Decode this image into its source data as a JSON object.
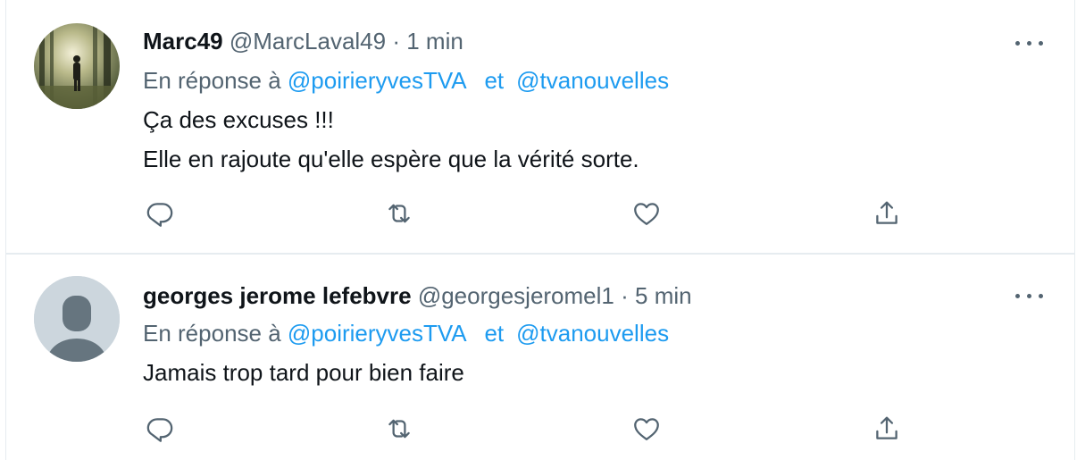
{
  "tweets": [
    {
      "name": "Marc49",
      "handle": "@MarcLaval49",
      "dot": "·",
      "time": "1 min",
      "reply_prefix": "En réponse à",
      "reply_to_1": "@poirieryvesTVA",
      "reply_and": "et",
      "reply_to_2": "@tvanouvelles",
      "text_line_1": "Ça des excuses !!!",
      "text_line_2": "Elle en rajoute qu'elle espère que la vérité sorte."
    },
    {
      "name": "georges jerome lefebvre",
      "handle": "@georgesjeromel1",
      "dot": "·",
      "time": "5 min",
      "reply_prefix": "En réponse à",
      "reply_to_1": "@poirieryvesTVA",
      "reply_and": "et",
      "reply_to_2": "@tvanouvelles",
      "text_line_1": "Jamais trop tard pour bien faire"
    }
  ],
  "icons": {
    "more": "more-horizontal-icon",
    "reply": "reply-icon",
    "retweet": "retweet-icon",
    "like": "heart-icon",
    "share": "share-icon"
  },
  "colors": {
    "link": "#1d9bf0",
    "secondary_text": "#536471",
    "primary_text": "#0f1419",
    "border": "#e6ecf0",
    "default_avatar_bg": "#ccd6dd",
    "default_avatar_fg": "#66757f"
  }
}
